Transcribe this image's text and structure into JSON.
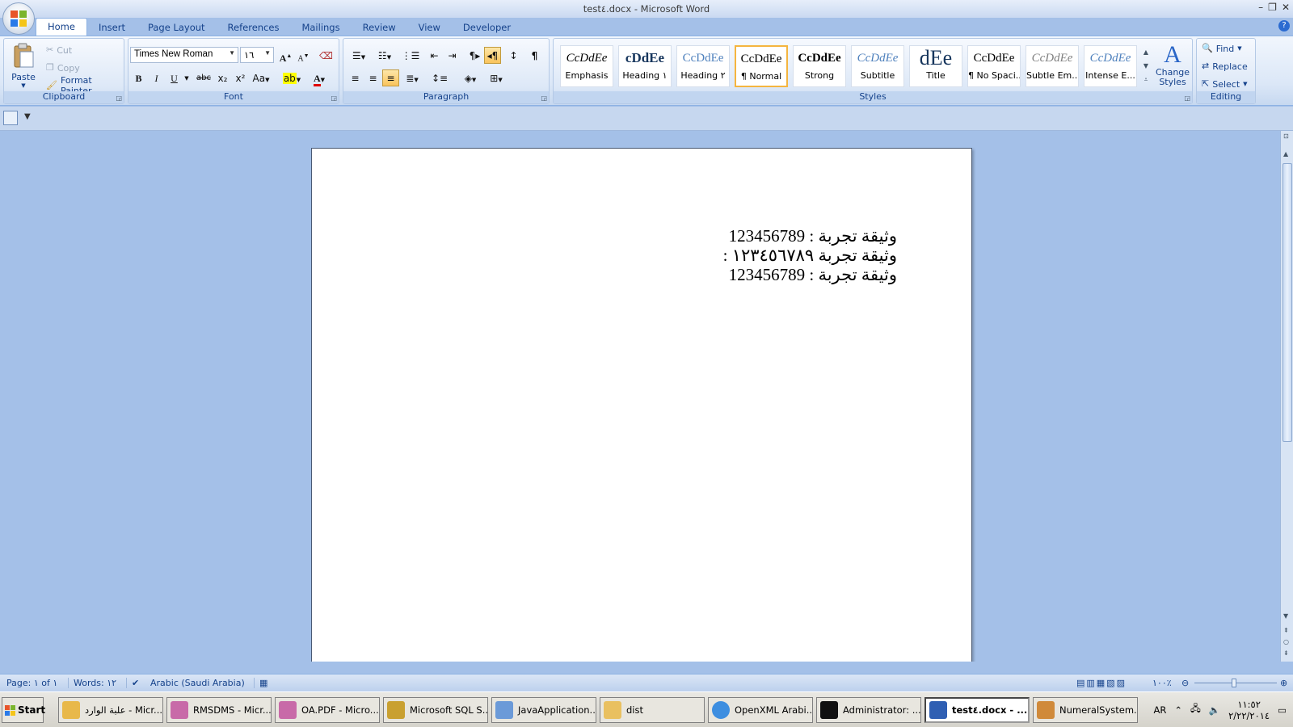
{
  "window": {
    "title": "test٤.docx - Microsoft Word",
    "minimize": "–",
    "maximize": "❐",
    "close": "✕"
  },
  "tabs": [
    "Home",
    "Insert",
    "Page Layout",
    "References",
    "Mailings",
    "Review",
    "View",
    "Developer"
  ],
  "help": "?",
  "clipboard": {
    "paste": "Paste",
    "cut": "Cut",
    "copy": "Copy",
    "format_painter": "Format Painter",
    "label": "Clipboard"
  },
  "font": {
    "name": "Times New Roman",
    "size": "١٦",
    "label": "Font",
    "bold": "B",
    "italic": "I",
    "underline": "U",
    "strike": "abc",
    "subscript": "x₂",
    "superscript": "x²",
    "change_case": "Aa",
    "grow": "A",
    "shrink": "A"
  },
  "paragraph": {
    "label": "Paragraph"
  },
  "styles": {
    "label": "Styles",
    "items": [
      {
        "preview": "CcDdEe",
        "name": "Emphasis"
      },
      {
        "preview": "cDdEe",
        "name": "Heading ١"
      },
      {
        "preview": "CcDdEe",
        "name": "Heading ٢"
      },
      {
        "preview": "CcDdEe",
        "name": "¶ Normal"
      },
      {
        "preview": "CcDdEe",
        "name": "Strong"
      },
      {
        "preview": "CcDdEe",
        "name": "Subtitle"
      },
      {
        "preview": "dEe",
        "name": "Title"
      },
      {
        "preview": "CcDdEe",
        "name": "¶ No Spaci..."
      },
      {
        "preview": "CcDdEe",
        "name": "Subtle Em..."
      },
      {
        "preview": "CcDdEe",
        "name": "Intense E..."
      }
    ],
    "change_styles": "Change Styles"
  },
  "editing": {
    "find": "Find",
    "replace": "Replace",
    "select": "Select",
    "label": "Editing"
  },
  "document": {
    "lines": [
      "وثيقة تجربة : 123456789",
      "وثيقة تجربة ١٢٣٤٥٦٧٨٩ :",
      "وثيقة تجربة : 123456789"
    ]
  },
  "status": {
    "page": "Page: ١ of ١",
    "words": "Words: ١٢",
    "language": "Arabic (Saudi Arabia)",
    "zoom": "١٠٠٪"
  },
  "taskbar": {
    "start": "Start",
    "items": [
      {
        "label": "علبة الوارد - Micr...",
        "color": "#e8b84a"
      },
      {
        "label": "RMSDMS - Micr...",
        "color": "#c86aa8"
      },
      {
        "label": "OA.PDF - Micro...",
        "color": "#c86aa8"
      },
      {
        "label": "Microsoft SQL S...",
        "color": "#c9a030"
      },
      {
        "label": "JavaApplication...",
        "color": "#6b9ad8"
      },
      {
        "label": "dist",
        "color": "#e9c060"
      },
      {
        "label": "OpenXML Arabi...",
        "color": "#3d8ee0"
      },
      {
        "label": "Administrator: ...",
        "color": "#111111"
      },
      {
        "label": "test٤.docx - ...",
        "color": "#2f5fb3"
      },
      {
        "label": "NumeralSystem...",
        "color": "#d08a3a"
      }
    ],
    "lang": "AR",
    "time": "١١:٥٢",
    "date": "٢/٢٢/٢٠١٤"
  }
}
